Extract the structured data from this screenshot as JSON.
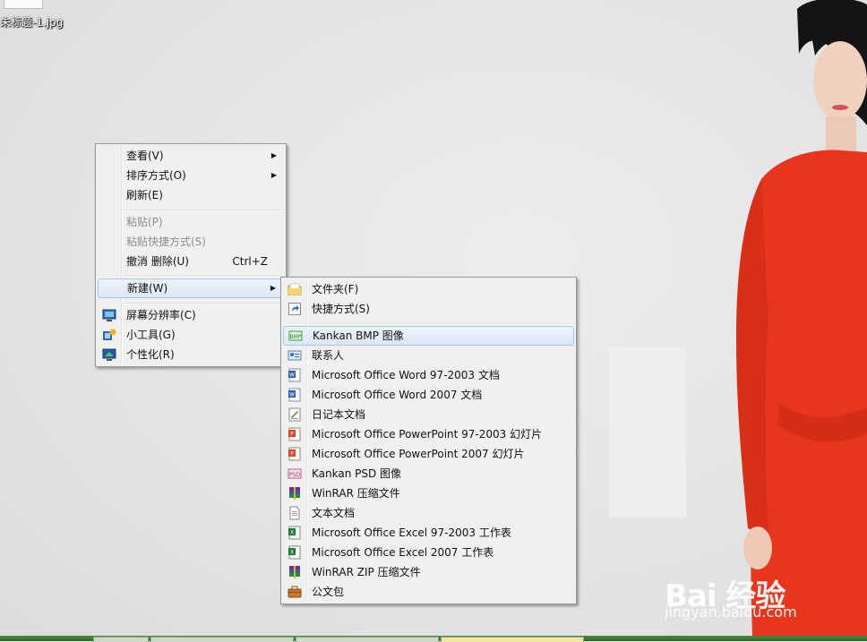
{
  "desktop": {
    "file_label": "未标题-1.jpg"
  },
  "context_menu": {
    "items": [
      {
        "label": "查看(V)",
        "submenu": true
      },
      {
        "label": "排序方式(O)",
        "submenu": true
      },
      {
        "label": "刷新(E)"
      },
      {
        "label": "粘贴(P)",
        "disabled": true
      },
      {
        "label": "粘贴快捷方式(S)",
        "disabled": true
      },
      {
        "label": "撤消 删除(U)",
        "shortcut": "Ctrl+Z"
      },
      {
        "label": "新建(W)",
        "submenu": true,
        "highlighted": true
      },
      {
        "label": "屏幕分辨率(C)",
        "icon": "screen-resolution-icon"
      },
      {
        "label": "小工具(G)",
        "icon": "gadgets-icon"
      },
      {
        "label": "个性化(R)",
        "icon": "personalize-icon"
      }
    ]
  },
  "new_submenu": {
    "items": [
      {
        "label": "文件夹(F)",
        "icon": "folder-icon"
      },
      {
        "label": "快捷方式(S)",
        "icon": "shortcut-icon"
      },
      {
        "label": "Kankan BMP 图像",
        "icon": "bmp-image-icon",
        "highlighted": true
      },
      {
        "label": "联系人",
        "icon": "contact-icon"
      },
      {
        "label": "Microsoft Office Word 97-2003 文档",
        "icon": "word-icon"
      },
      {
        "label": "Microsoft Office Word 2007 文档",
        "icon": "word-icon"
      },
      {
        "label": "日记本文档",
        "icon": "journal-icon"
      },
      {
        "label": "Microsoft Office PowerPoint 97-2003 幻灯片",
        "icon": "powerpoint-icon"
      },
      {
        "label": "Microsoft Office PowerPoint 2007 幻灯片",
        "icon": "powerpoint-icon"
      },
      {
        "label": "Kankan PSD 图像",
        "icon": "psd-image-icon"
      },
      {
        "label": "WinRAR 压缩文件",
        "icon": "winrar-icon"
      },
      {
        "label": "文本文档",
        "icon": "text-document-icon"
      },
      {
        "label": "Microsoft Office Excel 97-2003 工作表",
        "icon": "excel-icon"
      },
      {
        "label": "Microsoft Office Excel 2007 工作表",
        "icon": "excel-icon"
      },
      {
        "label": "WinRAR ZIP 压缩文件",
        "icon": "winrar-zip-icon"
      },
      {
        "label": "公文包",
        "icon": "briefcase-icon"
      }
    ]
  },
  "watermark": {
    "brand": "Bai 经验",
    "url": "jingyan.baidu.com"
  },
  "colors": {
    "menu_bg": "#f0f0f0",
    "highlight_border": "#a8c6ea",
    "dress": "#e8361c",
    "taskbar": "#3c7a2e"
  }
}
